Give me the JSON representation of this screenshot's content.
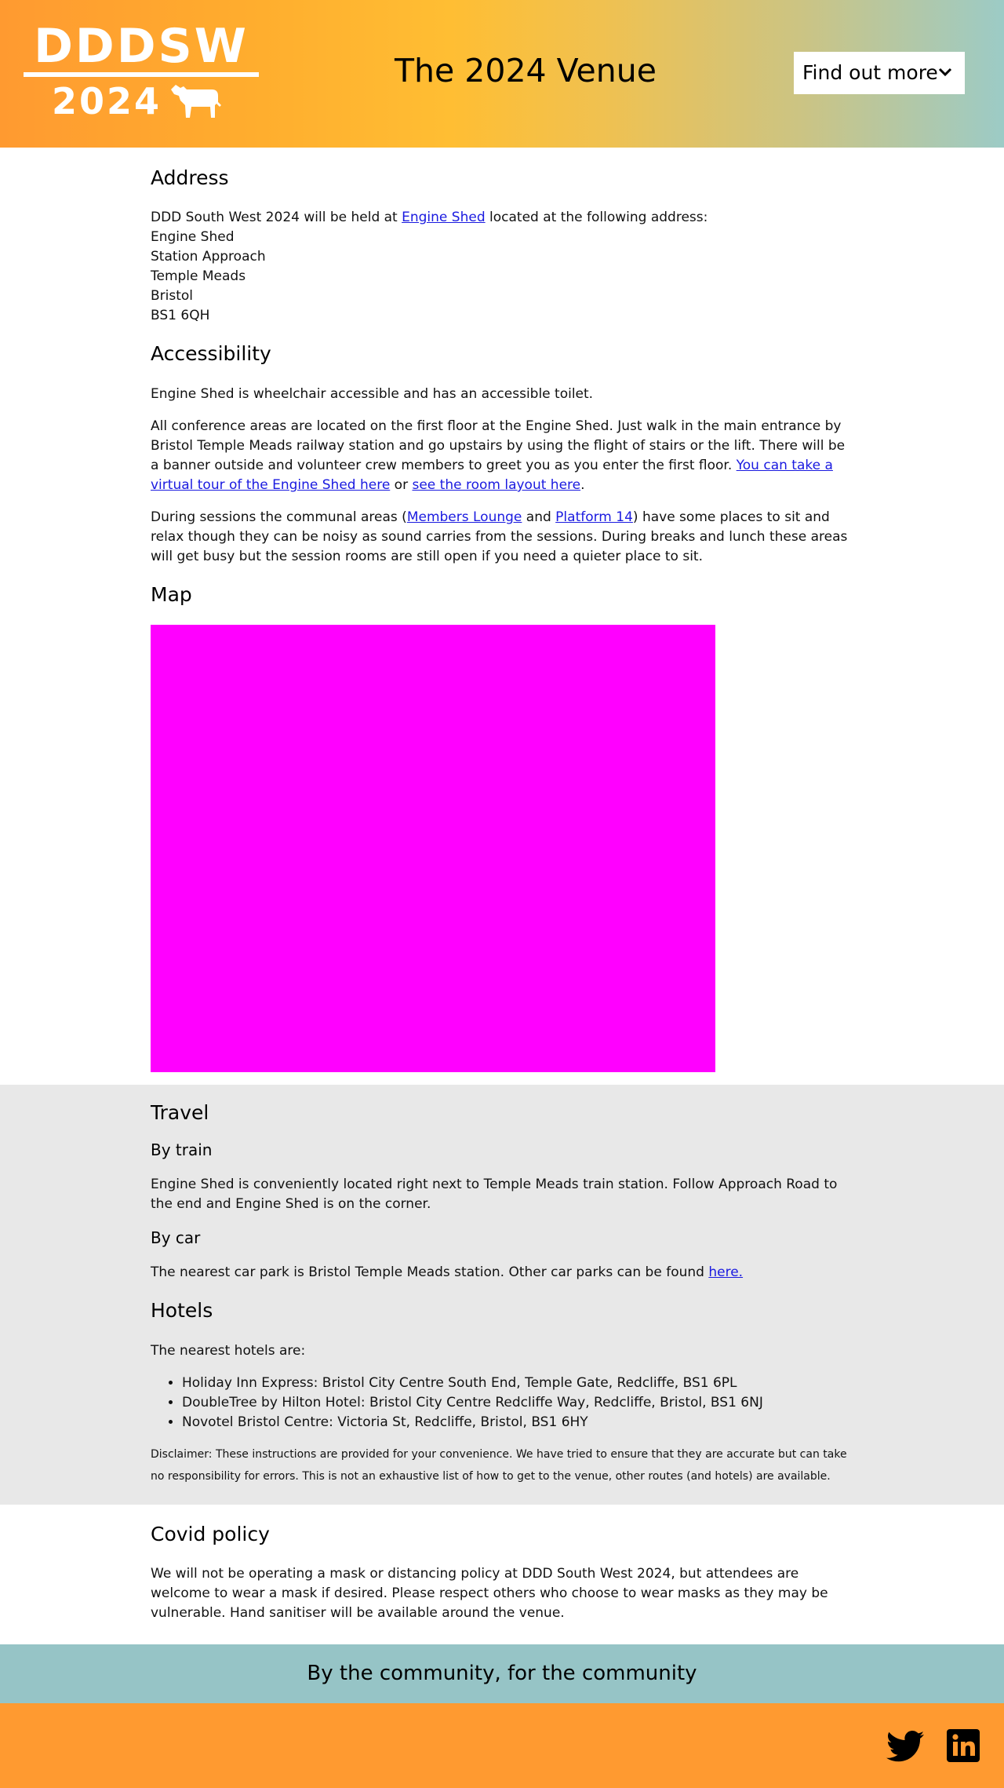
{
  "header": {
    "logo_text": "DDDSW",
    "logo_year": "2024",
    "title": "The 2024 Venue",
    "find_out_more": "Find out more",
    "colors": {
      "orange": "#ff9a30",
      "yellow": "#ffbe33",
      "teal": "#96c4c6"
    }
  },
  "address": {
    "heading": "Address",
    "intro_before": "DDD South West 2024 will be held at ",
    "venue_link": "Engine Shed",
    "intro_after": " located at the following address:",
    "lines": [
      "Engine Shed",
      "Station Approach",
      "Temple Meads",
      "Bristol",
      "BS1 6QH"
    ]
  },
  "accessibility": {
    "heading": "Accessibility",
    "p1": "Engine Shed is wheelchair accessible and has an accessible toilet.",
    "p2_text": "All conference areas are located on the first floor at the Engine Shed. Just walk in the main entrance by Bristol Temple Meads railway station and go upstairs by using the flight of stairs or the lift. There will be a banner outside and volunteer crew members to greet you as you enter the first floor. ",
    "p2_link1": "You can take a virtual tour of the Engine Shed here",
    "p2_mid": " or ",
    "p2_link2": "see the room layout here",
    "p2_end": ".",
    "p3_before": "During sessions the communal areas (",
    "p3_link1": "Members Lounge",
    "p3_and": " and ",
    "p3_link2": "Platform 14",
    "p3_after": ") have some places to sit and relax though they can be noisy as sound carries from the sessions. During breaks and lunch these areas will get busy but the session rooms are still open if you need a quieter place to sit."
  },
  "map": {
    "heading": "Map",
    "placeholder_color": "#ff00ff"
  },
  "travel": {
    "heading": "Travel",
    "train_heading": "By train",
    "train_text": "Engine Shed is conveniently located right next to Temple Meads train station. Follow Approach Road to the end and Engine Shed is on the corner.",
    "car_heading": "By car",
    "car_text": "The nearest car park is Bristol Temple Meads station. Other car parks can be found ",
    "car_link": "here."
  },
  "hotels": {
    "heading": "Hotels",
    "intro": "The nearest hotels are:",
    "items": [
      "Holiday Inn Express: Bristol City Centre South End, Temple Gate, Redcliffe, BS1 6PL",
      "DoubleTree by Hilton Hotel: Bristol City Centre Redcliffe Way, Redcliffe, Bristol, BS1 6NJ",
      "Novotel Bristol Centre: Victoria St, Redcliffe, Bristol, BS1 6HY"
    ],
    "disclaimer": "Disclaimer: These instructions are provided for your convenience. We have tried to ensure that they are accurate but can take no responsibility for errors. This is not an exhaustive list of how to get to the venue, other routes (and hotels) are available."
  },
  "covid": {
    "heading": "Covid policy",
    "text": "We will not be operating a mask or distancing policy at DDD South West 2024, but attendees are welcome to wear a mask if desired. Please respect others who choose to wear masks as they may be vulnerable. Hand sanitiser will be available around the venue."
  },
  "tagline": "By the community, for the community",
  "footer": {
    "icons": [
      "twitter-icon",
      "linkedin-icon"
    ]
  }
}
